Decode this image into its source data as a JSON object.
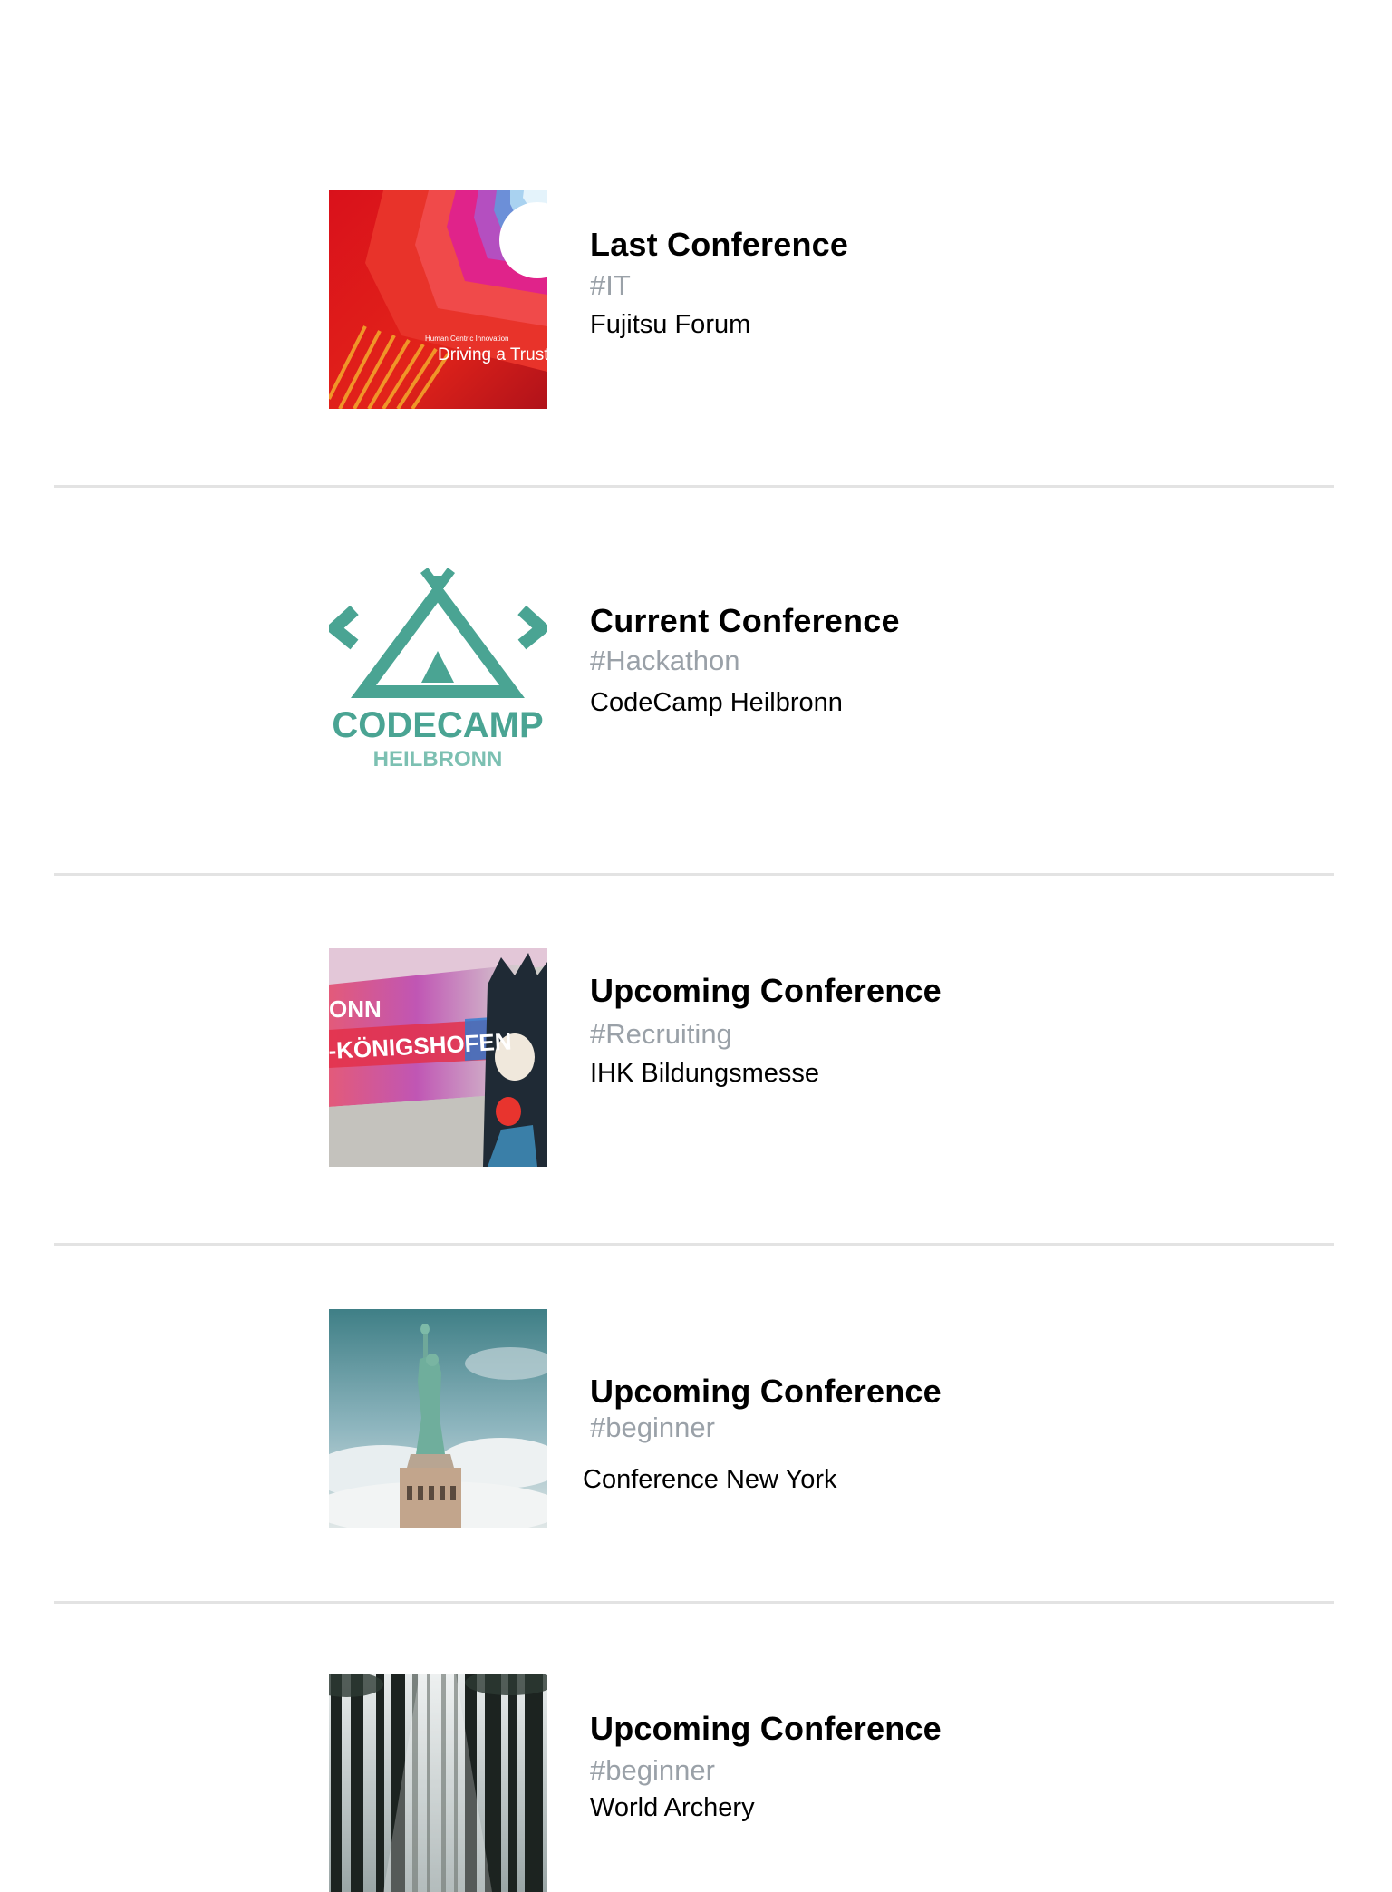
{
  "conferences": [
    {
      "title": "Last Conference",
      "tag": "#IT",
      "name": "Fujitsu Forum",
      "thumbnail": {
        "icon": "fujitsu-forum-banner",
        "caption_small": "Human Centric Innovation",
        "caption": "Driving a Trust"
      }
    },
    {
      "title": "Current Conference",
      "tag": "#Hackathon",
      "name": "CodeCamp Heilbronn",
      "thumbnail": {
        "icon": "codecamp-tent-logo",
        "logo_text": "CODECAMP",
        "logo_subtext": "HEILBRONN",
        "accent": "#4aa493"
      }
    },
    {
      "title": "Upcoming Conference",
      "tag": "#Recruiting",
      "name": "IHK Bildungsmesse",
      "thumbnail": {
        "icon": "bildungsmesse-poster",
        "line1": "ONN",
        "line2": "-KÖNIGSHOFEN"
      }
    },
    {
      "title": "Upcoming Conference",
      "tag": "#beginner",
      "name": "Conference New York",
      "thumbnail": {
        "icon": "statue-of-liberty-photo"
      }
    },
    {
      "title": "Upcoming Conference",
      "tag": "#beginner",
      "name": "World Archery",
      "thumbnail": {
        "icon": "forest-photo"
      }
    }
  ],
  "colors": {
    "title": "#000000",
    "tag": "#9aa1a8",
    "separator": "#e3e3e3",
    "background": "#ffffff"
  }
}
